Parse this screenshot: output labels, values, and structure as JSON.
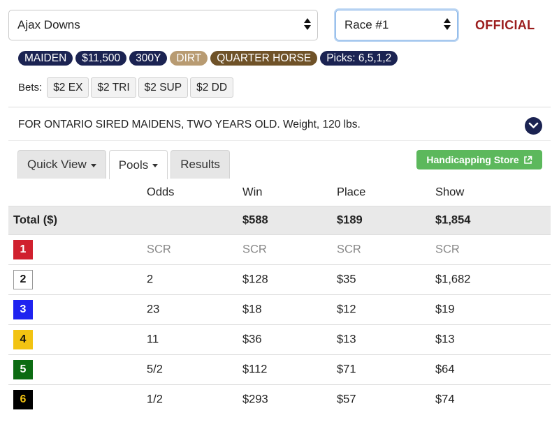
{
  "selectors": {
    "track": "Ajax Downs",
    "race": "Race #1"
  },
  "status": "OFFICIAL",
  "badges": [
    {
      "label": "MAIDEN",
      "color": "#1b2352"
    },
    {
      "label": "$11,500",
      "color": "#1b2352"
    },
    {
      "label": "300Y",
      "color": "#1b2352"
    },
    {
      "label": "DIRT",
      "color": "#b89b72"
    },
    {
      "label": "QUARTER HORSE",
      "color": "#6f5228"
    },
    {
      "label": "Picks: 6,5,1,2",
      "color": "#1b2352"
    }
  ],
  "bets": {
    "label": "Bets:",
    "items": [
      "$2 EX",
      "$2 TRI",
      "$2 SUP",
      "$2 DD"
    ]
  },
  "conditions": "FOR ONTARIO SIRED MAIDENS, TWO YEARS OLD. Weight, 120 lbs.",
  "tabs": [
    {
      "label": "Quick View",
      "dropdown": true,
      "active": false
    },
    {
      "label": "Pools",
      "dropdown": true,
      "active": true
    },
    {
      "label": "Results",
      "dropdown": false,
      "active": false
    }
  ],
  "store_button": "Handicapping Store",
  "table": {
    "headers": [
      "",
      "Odds",
      "Win",
      "Place",
      "Show"
    ],
    "total": {
      "label": "Total ($)",
      "odds": "",
      "win": "$588",
      "place": "$189",
      "show": "$1,854"
    },
    "rows": [
      {
        "pp": "1",
        "bg": "#d0202e",
        "fg": "#ffffff",
        "border": "#d0202e",
        "odds": "SCR",
        "win": "SCR",
        "place": "SCR",
        "show": "SCR",
        "scratched": true
      },
      {
        "pp": "2",
        "bg": "#ffffff",
        "fg": "#111111",
        "border": "#999999",
        "odds": "2",
        "win": "$128",
        "place": "$35",
        "show": "$1,682",
        "scratched": false
      },
      {
        "pp": "3",
        "bg": "#1f23f0",
        "fg": "#ffffff",
        "border": "#1f23f0",
        "odds": "23",
        "win": "$18",
        "place": "$12",
        "show": "$19",
        "scratched": false
      },
      {
        "pp": "4",
        "bg": "#f2c312",
        "fg": "#111111",
        "border": "#f2c312",
        "odds": "11",
        "win": "$36",
        "place": "$13",
        "show": "$13",
        "scratched": false
      },
      {
        "pp": "5",
        "bg": "#0c6b12",
        "fg": "#ffffff",
        "border": "#0c6b12",
        "odds": "5/2",
        "win": "$112",
        "place": "$71",
        "show": "$64",
        "scratched": false
      },
      {
        "pp": "6",
        "bg": "#000000",
        "fg": "#f2c312",
        "border": "#000000",
        "odds": "1/2",
        "win": "$293",
        "place": "$57",
        "show": "$74",
        "scratched": false
      }
    ]
  }
}
